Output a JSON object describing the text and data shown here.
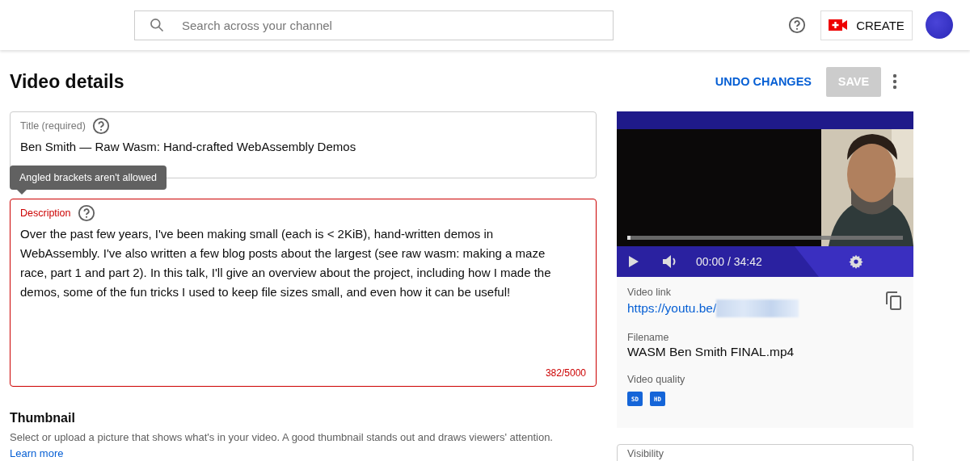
{
  "header": {
    "search": {
      "placeholder": "Search across your channel"
    },
    "create_button": "CREATE"
  },
  "page": {
    "title": "Video details",
    "undo_button": "UNDO CHANGES",
    "save_button": {
      "label": "SAVE",
      "disabled": true
    }
  },
  "title_field": {
    "label": "Title (required)",
    "value": "Ben Smith — Raw Wasm: Hand-crafted WebAssembly Demos",
    "error": false
  },
  "tooltip": "Angled brackets aren't allowed",
  "description_field": {
    "label": "Description",
    "value": "Over the past few years, I've been making small (each is < 2KiB), hand-written demos in WebAssembly. I've also written a few blog posts about the largest (see raw wasm: making a maze race, part 1 and part 2). In this talk, I'll give an overview about the project, including how I made the demos, some of the fun tricks I used to keep file sizes small, and even how it can be useful!",
    "counter": "382/5000",
    "error": true
  },
  "thumbnail": {
    "heading": "Thumbnail",
    "text": "Select or upload a picture that shows what's in your video. A good thumbnail stands out and draws viewers' attention.",
    "link": "Learn more"
  },
  "player": {
    "time": "00:00 / 34:42",
    "level": 0.01
  },
  "info": {
    "video_link": {
      "label": "Video link",
      "value": "https://youtu.be/"
    },
    "filename": {
      "label": "Filename",
      "value": "WASM Ben Smith FINAL.mp4"
    },
    "quality": {
      "label": "Video quality",
      "badges": [
        "SD",
        "HD"
      ]
    }
  },
  "visibility": {
    "label": "Visibility"
  }
}
